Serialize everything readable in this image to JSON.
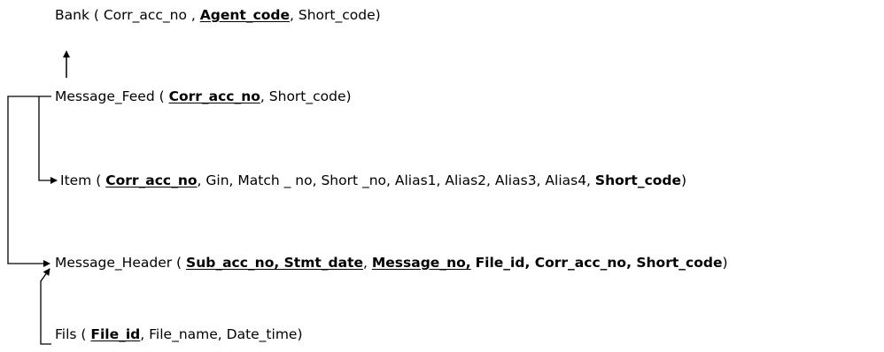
{
  "relations": [
    {
      "id": "bank",
      "name": "Bank",
      "open": " ( ",
      "parts": [
        {
          "text": "Corr_acc_no",
          "style": "normal"
        },
        {
          "text": " , ",
          "style": "normal"
        },
        {
          "text": "Agent_code",
          "style": "key"
        },
        {
          "text": ", ",
          "style": "normal"
        },
        {
          "text": "Short_code",
          "style": "normal"
        }
      ],
      "close": ")"
    },
    {
      "id": "message-feed",
      "name": "Message_Feed",
      "open": " ( ",
      "parts": [
        {
          "text": "Corr_acc_no",
          "style": "key"
        },
        {
          "text": ", ",
          "style": "normal"
        },
        {
          "text": "Short_code",
          "style": "normal"
        }
      ],
      "close": ")"
    },
    {
      "id": "item",
      "name": "Item",
      "open": " ( ",
      "parts": [
        {
          "text": "Corr_acc_no",
          "style": "key"
        },
        {
          "text": ", Gin, Match _ no, Short _no, Alias1, Alias2, Alias3, Alias4, ",
          "style": "normal"
        },
        {
          "text": "Short_code",
          "style": "bold"
        }
      ],
      "close": ")"
    },
    {
      "id": "message-header",
      "name": "Message_Header",
      "open": " ( ",
      "parts": [
        {
          "text": "Sub_acc_no, Stmt_date",
          "style": "key"
        },
        {
          "text": ", ",
          "style": "normal"
        },
        {
          "text": "Message_no,",
          "style": "key"
        },
        {
          "text": " ",
          "style": "normal"
        },
        {
          "text": "File_id, Corr_acc_no, Short_code",
          "style": "bold"
        }
      ],
      "close": ")"
    },
    {
      "id": "fils",
      "name": "Fils",
      "open": " ( ",
      "parts": [
        {
          "text": "File_id",
          "style": "key"
        },
        {
          "text": ", File_name, Date_time",
          "style": "normal"
        }
      ],
      "close": ")"
    }
  ]
}
